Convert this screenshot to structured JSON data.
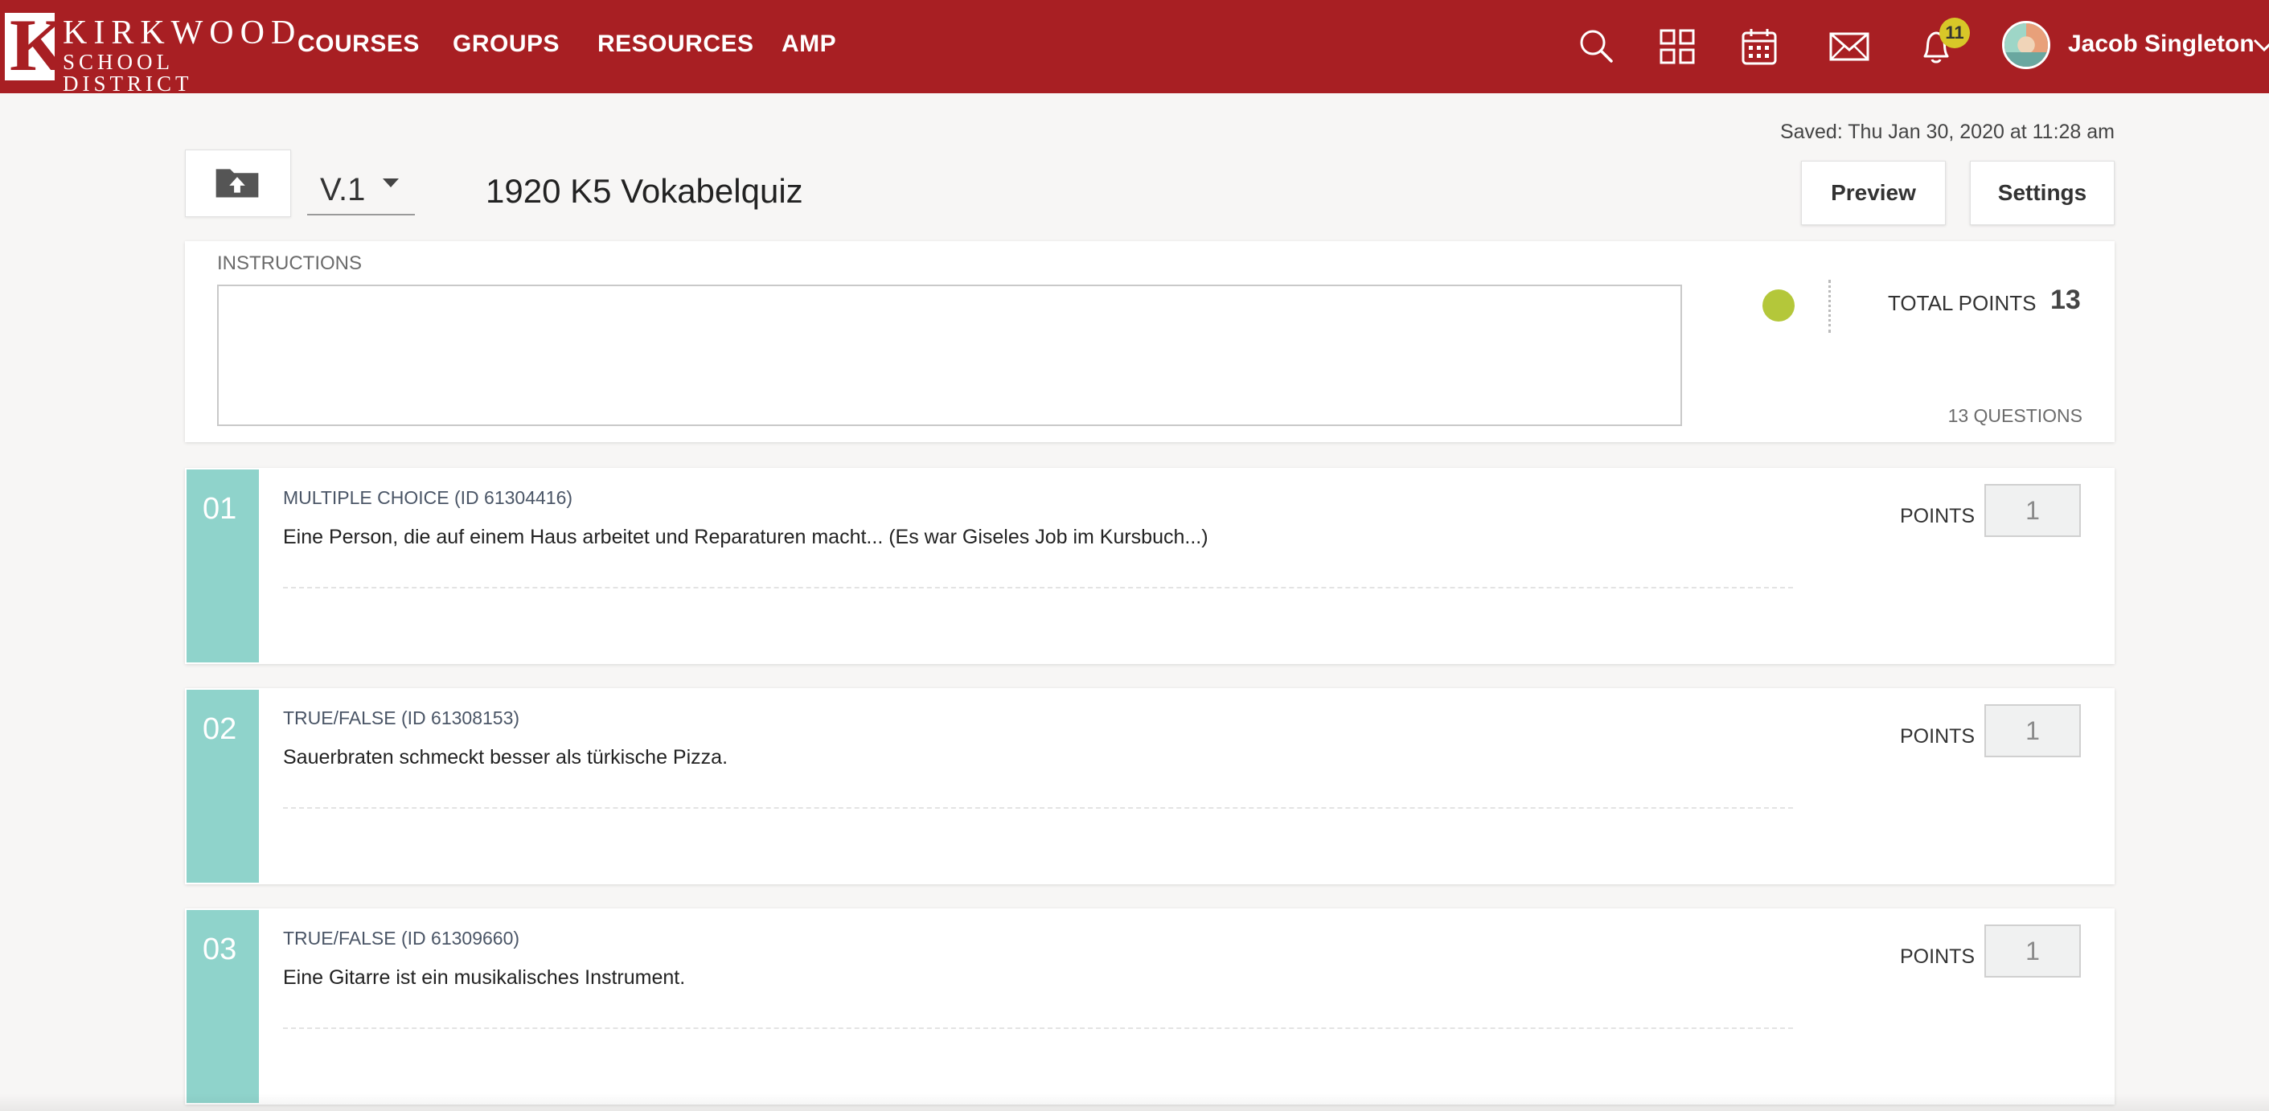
{
  "brand": {
    "logo_letter": "K",
    "logo_line1": "KIRKWOOD",
    "logo_line2": "SCHOOL DISTRICT",
    "color": "#a81f23"
  },
  "nav": {
    "items": [
      {
        "label": "COURSES"
      },
      {
        "label": "GROUPS"
      },
      {
        "label": "RESOURCES"
      },
      {
        "label": "AMP"
      }
    ]
  },
  "topbar_icons": [
    "search-icon",
    "apps-grid-icon",
    "calendar-icon",
    "mail-icon",
    "bell-icon"
  ],
  "notifications": {
    "count": "11"
  },
  "user": {
    "name": "Jacob Singleton"
  },
  "editor": {
    "saved_text": "Saved: Thu Jan 30, 2020 at 11:28 am",
    "version": "V.1",
    "title": "1920 K5 Vokabelquiz",
    "preview_label": "Preview",
    "settings_label": "Settings"
  },
  "instructions": {
    "label": "INSTRUCTIONS",
    "value": "",
    "status_color": "#b4c73a",
    "total_points_label": "TOTAL POINTS",
    "total_points": "13",
    "question_count": "13 QUESTIONS"
  },
  "questions": [
    {
      "num": "01",
      "type": "MULTIPLE CHOICE (ID 61304416)",
      "text": "Eine Person, die auf einem Haus arbeitet und Reparaturen macht... (Es war Giseles Job im Kursbuch...)",
      "points_label": "POINTS",
      "points": "1"
    },
    {
      "num": "02",
      "type": "TRUE/FALSE (ID 61308153)",
      "text": "Sauerbraten schmeckt besser als türkische Pizza.",
      "points_label": "POINTS",
      "points": "1"
    },
    {
      "num": "03",
      "type": "TRUE/FALSE (ID 61309660)",
      "text": "Eine Gitarre ist ein musikalisches Instrument.",
      "points_label": "POINTS",
      "points": "1"
    }
  ],
  "colors": {
    "question_number_bg": "#8fd3cb",
    "page_bg": "#f7f6f5"
  }
}
